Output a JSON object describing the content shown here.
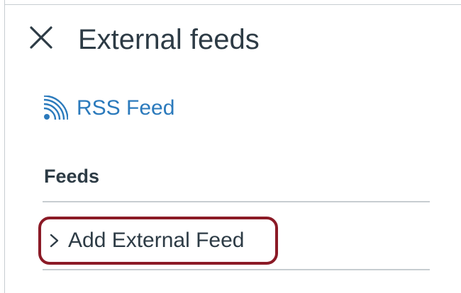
{
  "panel": {
    "title": "External feeds",
    "close_icon": "close-icon"
  },
  "rss": {
    "icon": "rss-icon",
    "label": "RSS Feed"
  },
  "feeds": {
    "heading": "Feeds",
    "add_label": "Add External Feed",
    "add_icon": "chevron-right-icon"
  },
  "colors": {
    "link": "#2b7abc",
    "text": "#2d3b45",
    "highlight": "#8b1a26",
    "divider": "#c7cdd1"
  }
}
